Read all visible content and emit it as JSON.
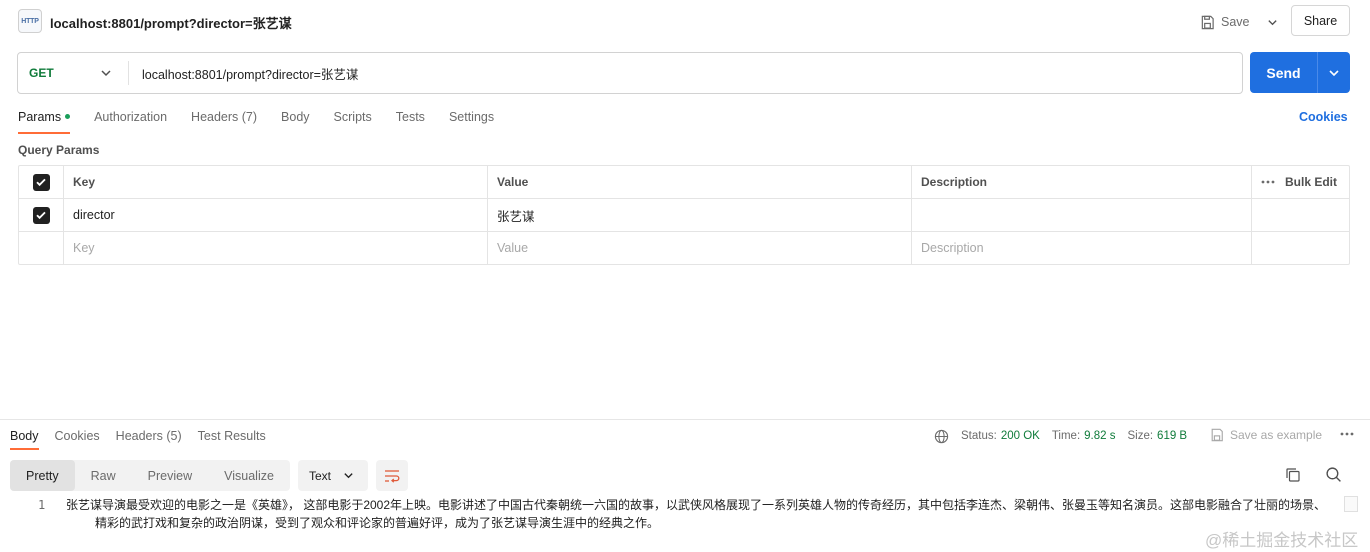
{
  "request": {
    "title": "localhost:8801/prompt?director=张艺谋",
    "icon_text": "HTTP",
    "method": "GET",
    "url": "localhost:8801/prompt?director=张艺谋"
  },
  "toolbar": {
    "save_label": "Save",
    "share_label": "Share",
    "send_label": "Send"
  },
  "request_tabs": [
    {
      "label": "Params",
      "active": true,
      "indicator": true
    },
    {
      "label": "Authorization"
    },
    {
      "label": "Headers (7)"
    },
    {
      "label": "Body"
    },
    {
      "label": "Scripts"
    },
    {
      "label": "Tests"
    },
    {
      "label": "Settings"
    }
  ],
  "cookies_label": "Cookies",
  "query_params": {
    "title": "Query Params",
    "headers": {
      "key": "Key",
      "value": "Value",
      "description": "Description",
      "bulk_edit": "Bulk Edit"
    },
    "rows": [
      {
        "checked": true,
        "key": "director",
        "value": "张艺谋",
        "description": ""
      }
    ],
    "placeholders": {
      "key": "Key",
      "value": "Value",
      "description": "Description"
    }
  },
  "response": {
    "tabs": [
      {
        "label": "Body",
        "active": true
      },
      {
        "label": "Cookies"
      },
      {
        "label": "Headers (5)"
      },
      {
        "label": "Test Results"
      }
    ],
    "status_label": "Status:",
    "status_value": "200 OK",
    "time_label": "Time:",
    "time_value": "9.82 s",
    "size_label": "Size:",
    "size_value": "619 B",
    "save_example": "Save as example",
    "view_options": [
      {
        "label": "Pretty",
        "active": true
      },
      {
        "label": "Raw"
      },
      {
        "label": "Preview"
      },
      {
        "label": "Visualize"
      }
    ],
    "format": "Text",
    "line_number": "1",
    "body_line_1": "张艺谋导演最受欢迎的电影之一是《英雄》， 这部电影于2002年上映。电影讲述了中国古代秦朝统一六国的故事，以武侠风格展现了一系列英雄人物的传奇经历，其中包括李连杰、梁朝伟、张曼玉等知名演员。这部电影融合了壮丽的场景、",
    "body_line_2": "精彩的武打戏和复杂的政治阴谋，受到了观众和评论家的普遍好评，成为了张艺谋导演生涯中的经典之作。"
  },
  "watermark": "@稀土掘金技术社区",
  "colors": {
    "accent": "#ff6c37",
    "send": "#1f6fe0",
    "method": "#0f7b3a",
    "status": "#0f7b3a"
  }
}
